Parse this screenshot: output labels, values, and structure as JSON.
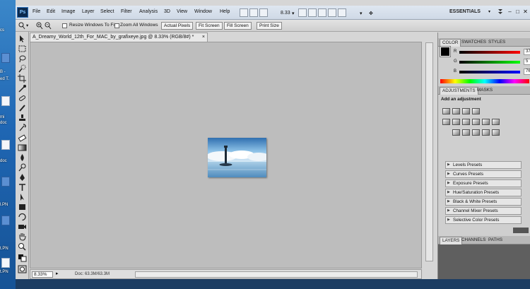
{
  "desktop": {
    "labels": [
      "cs",
      "B -",
      "ed T.",
      "mi",
      "doc",
      "doc",
      "l.PN",
      "t.PN",
      "t.PN"
    ]
  },
  "app": {
    "logo": "Ps",
    "menu": [
      "File",
      "Edit",
      "Image",
      "Layer",
      "Select",
      "Filter",
      "Analysis",
      "3D",
      "View",
      "Window",
      "Help"
    ],
    "zoom_control": "8.33",
    "workspace": "ESSENTIALS",
    "window_buttons": [
      "–",
      "□",
      "✕"
    ]
  },
  "options_bar": {
    "resize_windows_label": "Resize Windows To Fit",
    "zoom_all_label": "Zoom All Windows",
    "buttons": [
      "Actual Pixels",
      "Fit Screen",
      "Fill Screen",
      "Print Size"
    ]
  },
  "document": {
    "tab_title": "A_Dreamy_World_12th_For_MAC_by_grafixeye.jpg @ 8.33% (RGB/8#) *",
    "close": "×",
    "zoom": "8.33%",
    "doc_size": "Doc: 63.3M/63.3M"
  },
  "color_panel": {
    "tabs": [
      "COLOR",
      "SWATCHES",
      "STYLES"
    ],
    "channels": [
      {
        "letter": "R",
        "value": "37",
        "color": "#d01818"
      },
      {
        "letter": "G",
        "value": "5",
        "color": "#1a9a1a"
      },
      {
        "letter": "B",
        "value": "76",
        "color": "#1a2fcf"
      }
    ]
  },
  "adjustments_panel": {
    "tabs": [
      "ADJUSTMENTS",
      "MASKS"
    ],
    "heading": "Add an adjustment",
    "presets": [
      "Levels Presets",
      "Curves Presets",
      "Exposure Presets",
      "Hue/Saturation Presets",
      "Black & White Presets",
      "Channel Mixer Presets",
      "Selective Color Presets"
    ]
  },
  "layers_panel": {
    "tabs": [
      "LAYERS",
      "CHANNELS",
      "PATHS"
    ]
  },
  "colors": {
    "accent": "#2d6fb8",
    "panel_bg": "#cfcfcf",
    "canvas_bg": "#bdbdbd"
  }
}
